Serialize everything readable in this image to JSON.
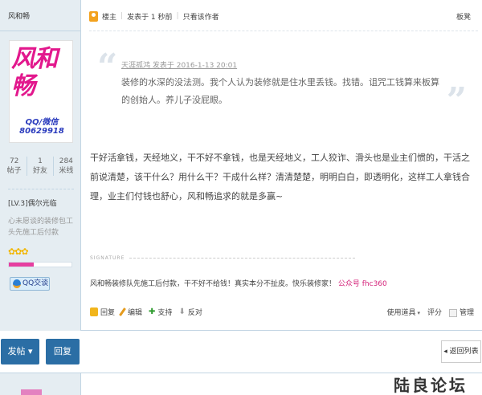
{
  "post": {
    "username": "风和畅",
    "avatar": {
      "calligraphy": "风和畅",
      "contact": "QQ/微信80629918"
    },
    "stats": [
      {
        "value": "72",
        "label": "帖子"
      },
      {
        "value": "1",
        "label": "好友"
      },
      {
        "value": "284",
        "label": "米线"
      }
    ],
    "level": "[LV.3]偶尔光临",
    "short_signature": "心未愿谈的装修包工头先施工后付款",
    "stars": "✿✿✿",
    "progress_fraction": 0.4,
    "qq_button": "QQ交谈",
    "meta": {
      "role": "楼主",
      "posted": "发表于 1 秒前",
      "author_only": "只看该作者",
      "floor": "板凳"
    },
    "quote": {
      "meta": "天涯孤鸿 发表于 2016-1-13 20:01",
      "text": "装修的水深的没法测。我个人认为装修就是住水里丢钱。找错。诅咒工钱算来板算的创始人。养儿子没屁眼。"
    },
    "content": "干好活拿钱，天经地义，干不好不拿钱，也是天经地义，工人狡诈、滑头也是业主们惯的，干活之前说清楚，该干什么？用什么干？干成什么样？清清楚楚，明明白白，即透明化，这样工人拿钱合理，业主们付钱也舒心，风和畅追求的就是多赢~",
    "signature_label": "SIGNATURE",
    "signature": "风和畅装修队先施工后付款，干不好不给钱！真实本分不扯皮。快乐装修家！",
    "signature_highlight": "公众号 fhc360",
    "actions": {
      "reply": "回复",
      "edit": "编辑",
      "support": "支持",
      "oppose": "反对",
      "tools": "使用道具",
      "rate": "评分",
      "manage": "管理"
    }
  },
  "bottombar": {
    "post_button": "发帖 ▾",
    "reply_button": "回复",
    "back_button": "◂ 返回列表"
  },
  "watermark": "陆良论坛",
  "colors": {
    "side_bg": "#e5edf2",
    "border": "#c2d5e3",
    "button_blue": "#2b6ea5",
    "pink": "#e2188d",
    "highlight_red": "#d4237a"
  }
}
